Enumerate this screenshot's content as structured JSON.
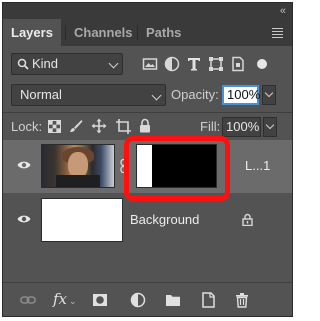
{
  "panel": {
    "collapse_glyph": "«"
  },
  "tabs": [
    {
      "label": "Layers",
      "active": true
    },
    {
      "label": "Channels",
      "active": false
    },
    {
      "label": "Paths",
      "active": false
    }
  ],
  "filter": {
    "kind_label": "Kind",
    "filter_icons": [
      "image-filter-icon",
      "adjustment-filter-icon",
      "type-filter-icon",
      "shape-filter-icon",
      "smart-object-filter-icon",
      "filter-toggle-icon"
    ]
  },
  "blend": {
    "mode": "Normal",
    "opacity_label": "Opacity:",
    "opacity_value": "100%"
  },
  "lock": {
    "label": "Lock:",
    "fill_label": "Fill:",
    "fill_value": "100%"
  },
  "layers": [
    {
      "name": "L...1",
      "selected": true,
      "visible": true,
      "has_mask": true
    },
    {
      "name": "Background",
      "selected": false,
      "visible": true,
      "locked": true
    }
  ],
  "bottom_icons": [
    "link-layers-icon",
    "layer-style-icon",
    "add-mask-icon",
    "adjustment-layer-icon",
    "new-group-icon",
    "new-layer-icon",
    "delete-layer-icon"
  ],
  "colors": {
    "highlight": "#ff1010",
    "focus": "#4a90d9"
  }
}
